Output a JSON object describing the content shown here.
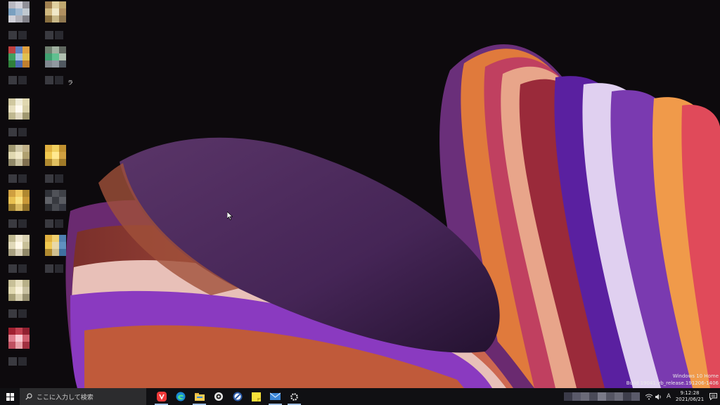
{
  "watermark": {
    "edition": "Windows 10 Home",
    "build": "Build 19041.vb_release.191206-1406"
  },
  "taskbar": {
    "search_placeholder": "ここに入力して検索",
    "apps": [
      "vivaldi-icon",
      "edge-icon",
      "file-explorer-icon",
      "app-icon",
      "browser-icon",
      "sticky-notes-icon",
      "mail-icon",
      "settings-icon"
    ],
    "tray": {
      "ime_label": "A",
      "time": "9:12:28",
      "date": "2021/06/21"
    }
  },
  "desktop": {
    "partial_label": "ラ"
  },
  "colors": {
    "taskbar": "#101013",
    "search_box": "#2c2c2e",
    "wallpaper_background": "#0d0a0d",
    "wallpaper_purple": "#4a2a58",
    "accent": "#9fbde0"
  }
}
